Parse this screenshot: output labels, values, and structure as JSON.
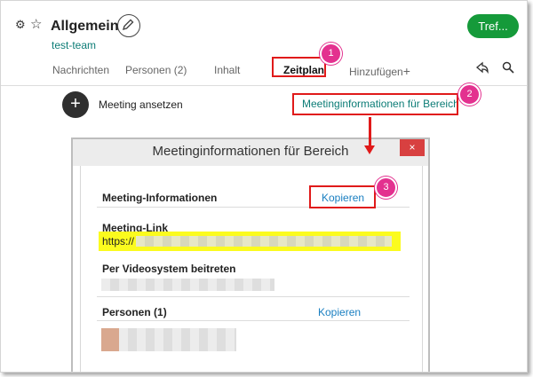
{
  "header": {
    "title": "Allgemein",
    "team": "test-team",
    "meet_button": "Tref...",
    "tabs": [
      "Nachrichten",
      "Personen (2)",
      "Inhalt",
      "Zeitplan",
      "Hinzufügen"
    ],
    "add_symbol": "+"
  },
  "schedule": {
    "plus_symbol": "+",
    "label": "Meeting ansetzen",
    "info_link": "Meetinginformationen für Bereich"
  },
  "dialog": {
    "title": "Meetinginformationen für Bereich",
    "close": "×",
    "section_info": "Meeting-Informationen",
    "copy_label": "Kopieren",
    "link_label": "Meeting-Link",
    "link_prefix": "https://",
    "video_label": "Per Videosystem beitreten",
    "persons_label": "Personen (1)",
    "persons_copy": "Kopieren"
  },
  "annotations": {
    "badge1": "1",
    "badge2": "2",
    "badge3": "3"
  },
  "icons": {
    "settings": "gear-icon",
    "favorite": "star-icon",
    "edit": "pencil-icon",
    "share": "share-icon",
    "search": "search-icon",
    "close": "close-icon"
  },
  "colors": {
    "team": "#0c7c76",
    "meet_button": "#159a3a",
    "link": "#1a7fc1",
    "annotation_box": "#e01a1a",
    "badge": "#e3318f",
    "highlight": "#fbfb1e",
    "close_button": "#d84040"
  }
}
